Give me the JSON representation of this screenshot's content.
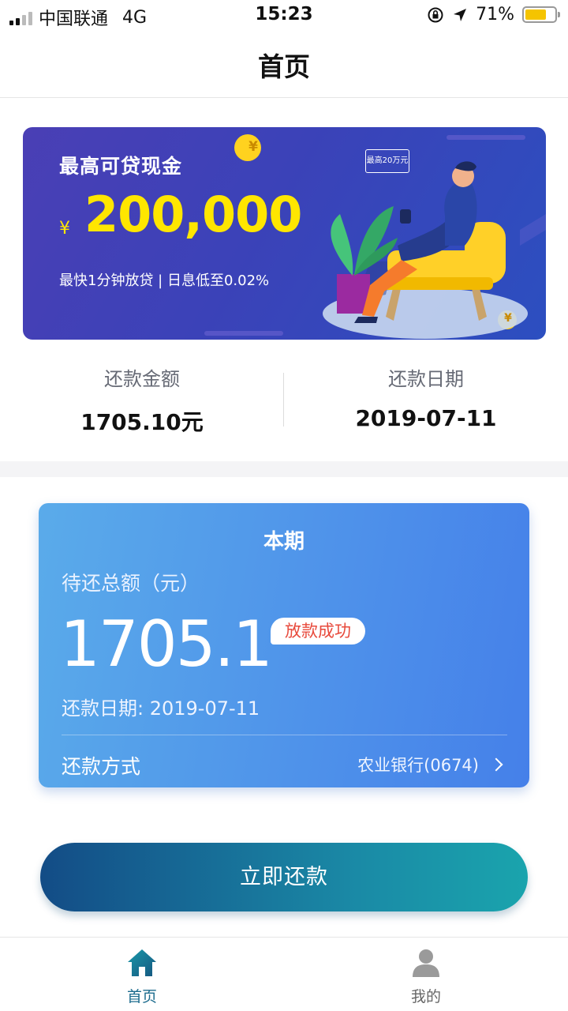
{
  "status_bar": {
    "carrier": "中国联通",
    "network": "4G",
    "time": "15:23",
    "battery": "71%",
    "battery_level": 0.71,
    "icons": [
      "signal-icon",
      "orientation-lock-icon",
      "location-arrow-icon",
      "battery-icon"
    ]
  },
  "nav": {
    "title": "首页"
  },
  "banner": {
    "heading": "最高可贷现金",
    "currency_symbol": "¥",
    "amount": "200,000",
    "subtitle": "最快1分钟放贷 | 日息低至0.02%",
    "bubble_text": "最高20万元",
    "coin_symbol": "¥",
    "colors": {
      "amount": "#ffe600",
      "background": "#3b42b8"
    }
  },
  "summary": {
    "amount_label": "还款金额",
    "amount_value": "1705.10元",
    "date_label": "还款日期",
    "date_value": "2019-07-11"
  },
  "period_card": {
    "title": "本期",
    "total_label": "待还总额（元）",
    "total_amount": "1705.1",
    "status_badge": "放款成功",
    "due_date": "还款日期: 2019-07-11",
    "method_label": "还款方式",
    "bank": "农业银行(0674)"
  },
  "repay_button": {
    "label": "立即还款"
  },
  "tabbar": {
    "items": [
      {
        "label": "首页",
        "icon": "home-icon",
        "active": true
      },
      {
        "label": "我的",
        "icon": "user-icon",
        "active": false
      }
    ],
    "active_color": "#1b6b8d"
  }
}
